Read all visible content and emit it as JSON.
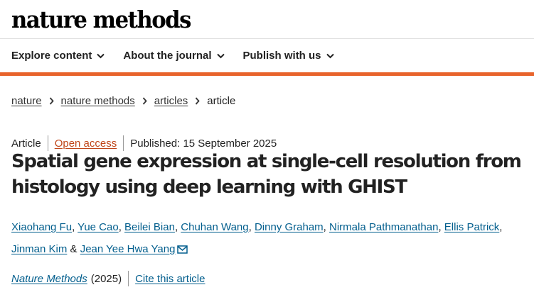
{
  "header": {
    "logo_text": "nature methods"
  },
  "nav": {
    "items": [
      {
        "label": "Explore content"
      },
      {
        "label": "About the journal"
      },
      {
        "label": "Publish with us"
      }
    ],
    "accent_color": "#e8632b"
  },
  "breadcrumb": {
    "items": [
      {
        "label": "nature"
      },
      {
        "label": "nature methods"
      },
      {
        "label": "articles"
      }
    ],
    "current": "article"
  },
  "article": {
    "type": "Article",
    "access": "Open access",
    "published": "Published: 15 September 2025",
    "title": "Spatial gene expression at single-cell resolution from histology using deep learning with GHIST",
    "authors": [
      "Xiaohang Fu",
      "Yue Cao",
      "Beilei Bian",
      "Chuhan Wang",
      "Dinny Graham",
      "Nirmala Pathmanathan",
      "Ellis Patrick",
      "Jinman Kim",
      "Jean Yee Hwa Yang"
    ],
    "author_separator": ", ",
    "author_joiner": "&",
    "journal": "Nature Methods",
    "year": "(2025)",
    "cite_label": "Cite this article",
    "link_color": "#025e8d"
  }
}
